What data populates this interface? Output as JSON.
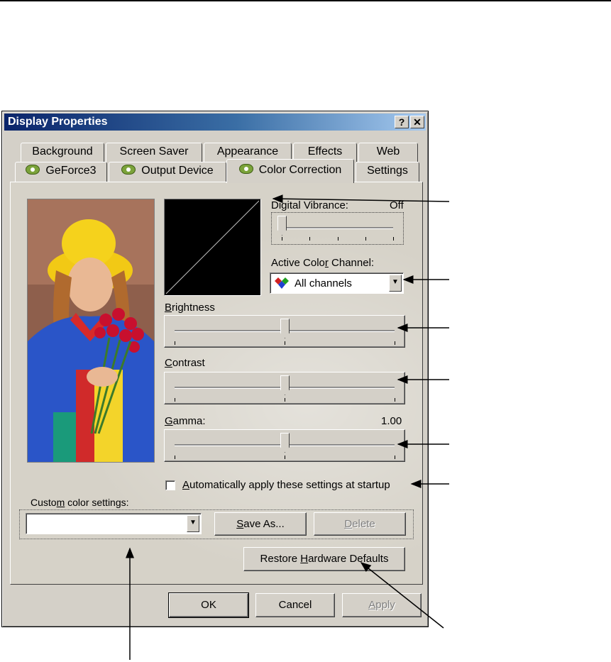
{
  "window": {
    "title": "Display Properties",
    "help_button": "?",
    "close_button": "✕"
  },
  "tabs_row1": [
    "Background",
    "Screen Saver",
    "Appearance",
    "Effects",
    "Web"
  ],
  "tabs_row2": [
    "GeForce3",
    "Output Device",
    "Color Correction",
    "Settings"
  ],
  "controls": {
    "digital_vibrance_label": "Digital Vibrance:",
    "digital_vibrance_value": "Off",
    "active_channel_label": "Active Color Channel:",
    "active_channel_value": "All channels",
    "brightness_label": "Brightness",
    "contrast_label": "Contrast",
    "gamma_label": "Gamma:",
    "gamma_value": "1.00",
    "auto_apply_label": "Automatically apply these settings at startup",
    "auto_apply_checked": false,
    "custom_settings_label": "Custom color settings:",
    "custom_settings_value": "",
    "save_as_label": "Save As...",
    "delete_label": "Delete",
    "restore_label": "Restore Hardware Defaults"
  },
  "slider_levels": {
    "digital_vibrance": 0,
    "brightness": 0.5,
    "contrast": 0.5,
    "gamma": 0.5
  },
  "footer": {
    "ok_label": "OK",
    "cancel_label": "Cancel",
    "apply_label": "Apply"
  },
  "icons": {
    "nvidia": "nvidia-eye-icon",
    "channels": "rgb-diamond-icon"
  },
  "colors": {
    "title_bar": "#0a246a",
    "face": "#d4d0c8"
  }
}
